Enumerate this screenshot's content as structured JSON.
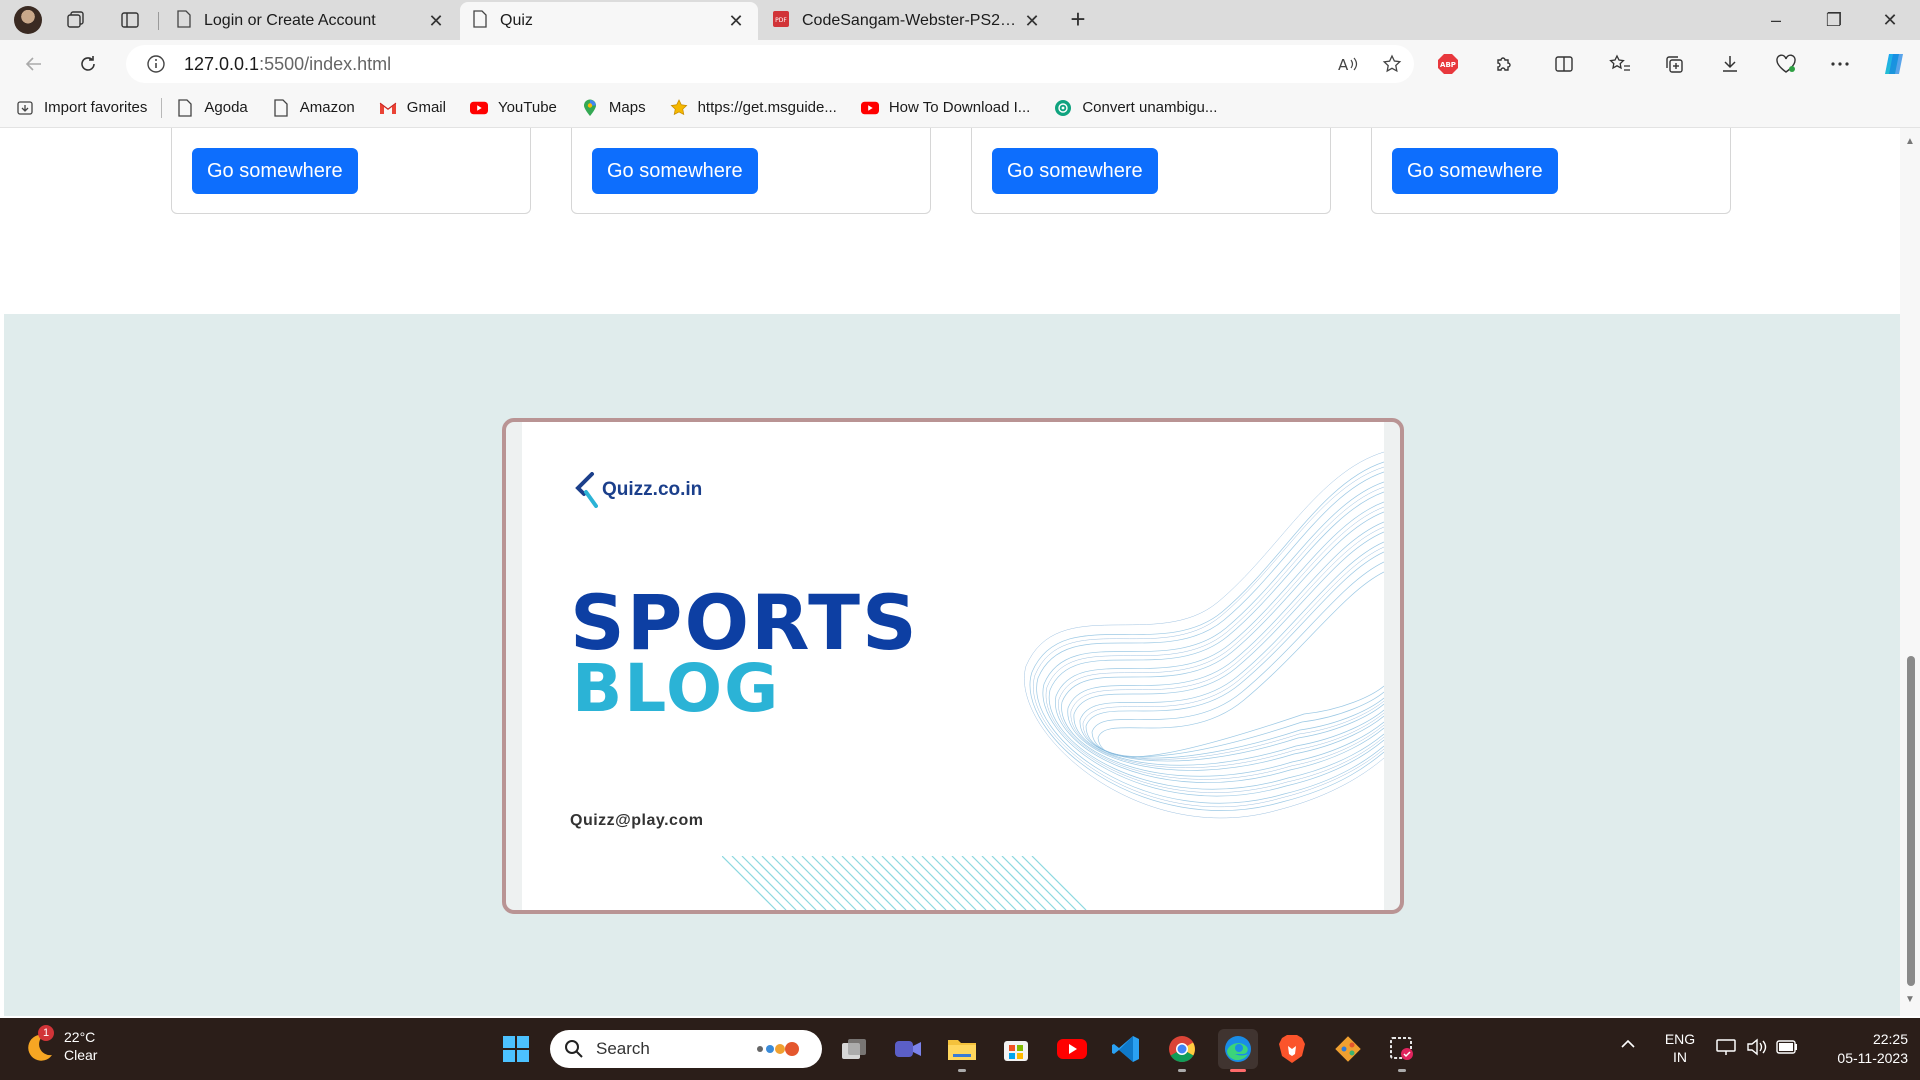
{
  "browser": {
    "tabs": [
      {
        "label": "Login or Create Account",
        "icon": "page-icon"
      },
      {
        "label": "Quiz",
        "icon": "page-icon"
      },
      {
        "label": "CodeSangam-Webster-PS23.pdf",
        "icon": "pdf-icon"
      }
    ],
    "active_tab": "Quiz",
    "new_tab": "+",
    "window_controls": {
      "minimize": "–",
      "restore": "❐",
      "close": "✕"
    },
    "address": {
      "host": "127.0.0.1",
      "path": ":5500/index.html"
    },
    "favorites": [
      {
        "label": "Import favorites",
        "icon": "import-icon"
      },
      {
        "label": "Agoda",
        "icon": "page-icon"
      },
      {
        "label": "Amazon",
        "icon": "page-icon"
      },
      {
        "label": "Gmail",
        "icon": "gmail-icon"
      },
      {
        "label": "YouTube",
        "icon": "youtube-icon"
      },
      {
        "label": "Maps",
        "icon": "maps-icon"
      },
      {
        "label": "https://get.msguide...",
        "icon": "star-icon"
      },
      {
        "label": "How To Download I...",
        "icon": "youtube-icon"
      },
      {
        "label": "Convert unambigu...",
        "icon": "chatgpt-icon"
      }
    ],
    "extensions": {
      "abp": "ABP"
    }
  },
  "page": {
    "cards": [
      {
        "button": "Go somewhere"
      },
      {
        "button": "Go somewhere"
      },
      {
        "button": "Go somewhere"
      },
      {
        "button": "Go somewhere"
      }
    ],
    "promo": {
      "brand": "Quizz.co.in",
      "title_1": "SPORTS",
      "title_2": "BLOG",
      "email": "Quizz@play.com"
    },
    "colors": {
      "button": "#0d6efd",
      "footer_bg": "#e0ecec",
      "title_1": "#0d3fa3",
      "title_2": "#2bb3d6",
      "frame": "#b99494"
    }
  },
  "taskbar": {
    "weather": {
      "temp": "22°C",
      "condition": "Clear",
      "badge": "1"
    },
    "search_placeholder": "Search",
    "language": {
      "line1": "ENG",
      "line2": "IN"
    },
    "time": "22:25",
    "date": "05-11-2023"
  }
}
